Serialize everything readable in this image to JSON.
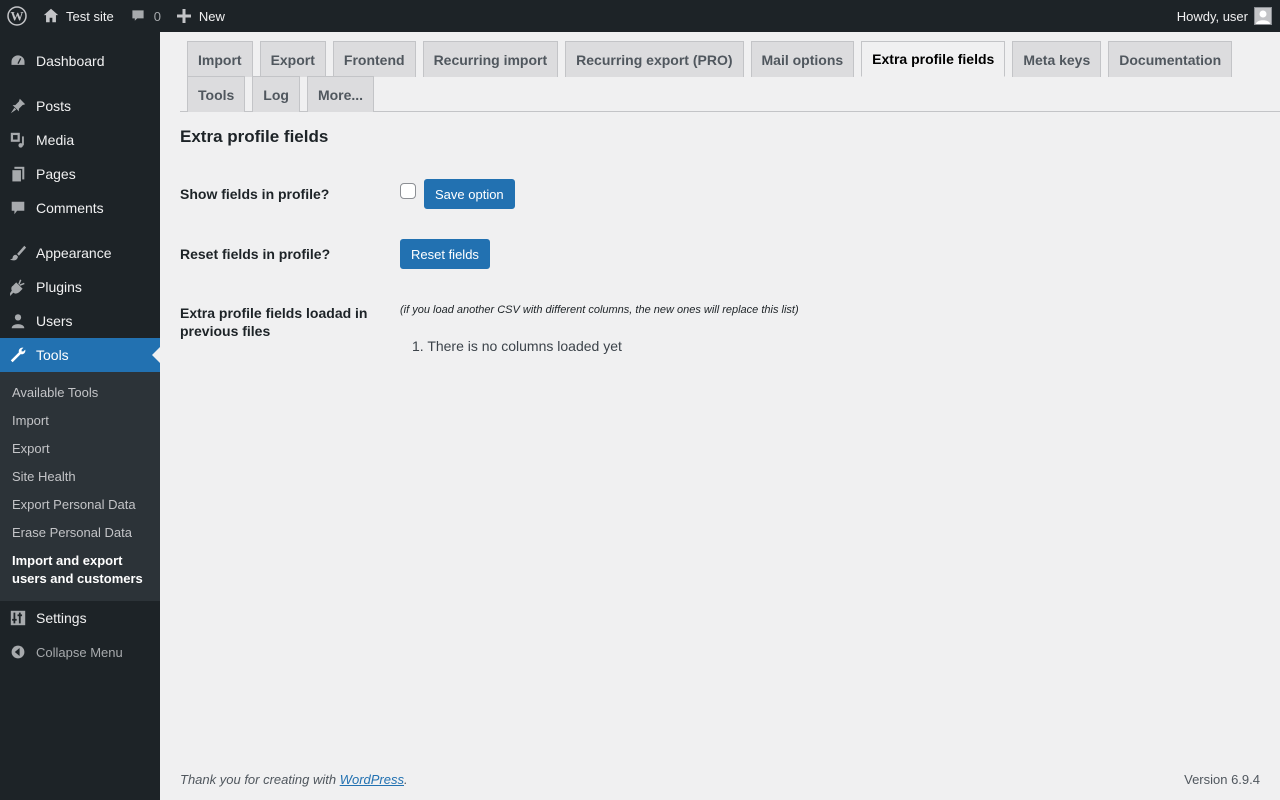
{
  "adminbar": {
    "site_name": "Test site",
    "comments_count": "0",
    "new_label": "New",
    "howdy": "Howdy, user"
  },
  "sidebar": {
    "items": [
      {
        "label": "Dashboard",
        "icon": "dashboard-icon"
      },
      {
        "label": "Posts",
        "icon": "pin-icon"
      },
      {
        "label": "Media",
        "icon": "media-icon"
      },
      {
        "label": "Pages",
        "icon": "pages-icon"
      },
      {
        "label": "Comments",
        "icon": "comment-icon"
      },
      {
        "label": "Appearance",
        "icon": "brush-icon"
      },
      {
        "label": "Plugins",
        "icon": "plug-icon"
      },
      {
        "label": "Users",
        "icon": "user-icon"
      },
      {
        "label": "Tools",
        "icon": "wrench-icon"
      },
      {
        "label": "Settings",
        "icon": "settings-icon"
      }
    ],
    "tools_submenu": [
      "Available Tools",
      "Import",
      "Export",
      "Site Health",
      "Export Personal Data",
      "Erase Personal Data",
      "Import and export users and customers"
    ],
    "collapse_label": "Collapse Menu"
  },
  "tabs": [
    "Import",
    "Export",
    "Frontend",
    "Recurring import",
    "Recurring export (PRO)",
    "Mail options",
    "Extra profile fields",
    "Meta keys",
    "Documentation",
    "Tools",
    "Log",
    "More..."
  ],
  "active_tab": "Extra profile fields",
  "main": {
    "title": "Extra profile fields",
    "show_fields_label": "Show fields in profile?",
    "show_fields_checked": false,
    "save_button": "Save option",
    "reset_label": "Reset fields in profile?",
    "reset_button": "Reset fields",
    "loaded_label": "Extra profile fields loadad in previous files",
    "loaded_note": "(if you load another CSV with different columns, the new ones will replace this list)",
    "loaded_items": [
      "There is no columns loaded yet"
    ]
  },
  "footer": {
    "thanks_prefix": "Thank you for creating with ",
    "thanks_link": "WordPress",
    "thanks_suffix": ".",
    "version": "Version 6.9.4"
  },
  "colors": {
    "accent": "#2271b1",
    "admin_bg": "#1d2327",
    "submenu_bg": "#2c3338",
    "page_bg": "#f0f0f1"
  }
}
